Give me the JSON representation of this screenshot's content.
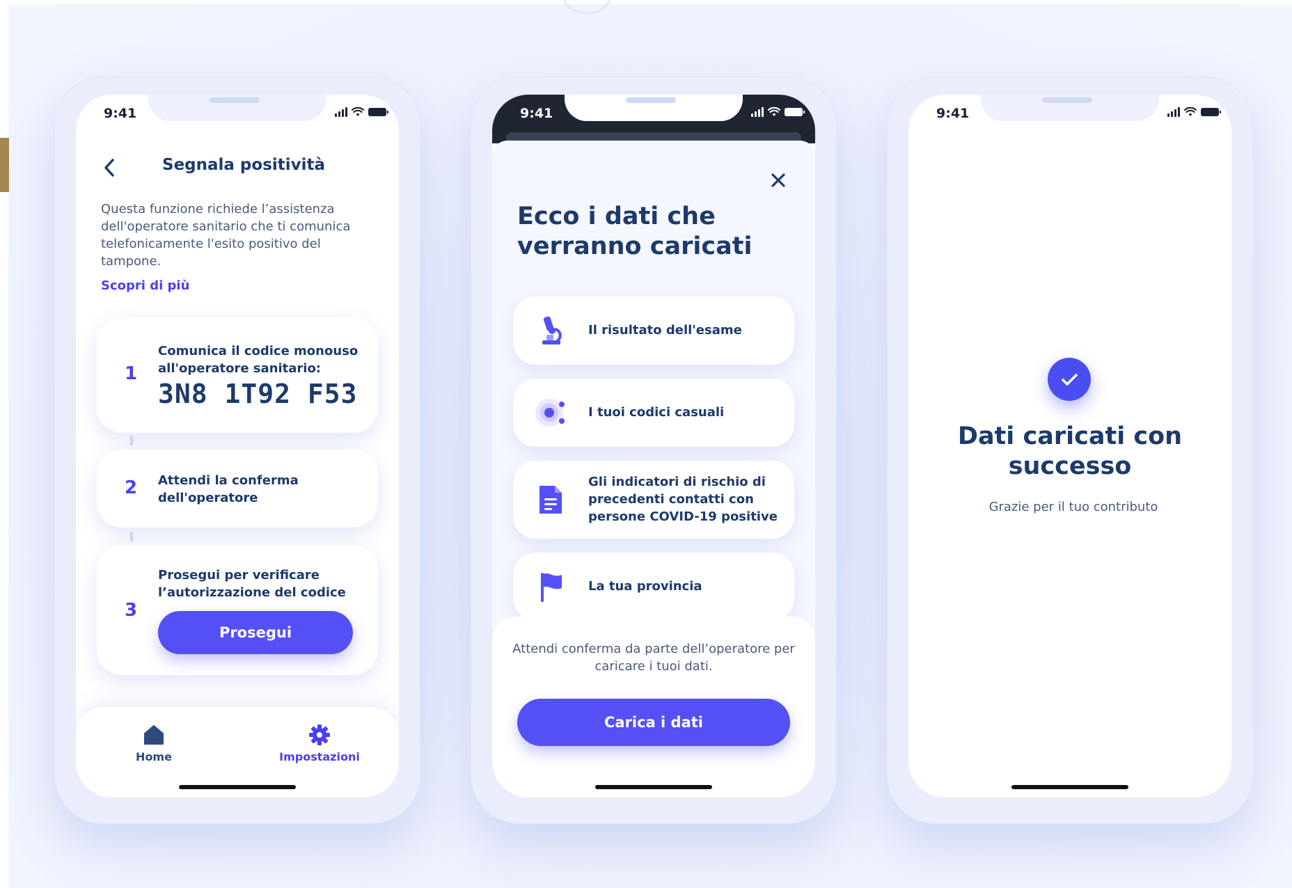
{
  "status_bar": {
    "time": "9:41"
  },
  "phone1": {
    "title": "Segnala positività",
    "description": "Questa funzione richiede l’assistenza dell'operatore sanitario che ti comunica telefonicamente l'esito positivo del tampone.",
    "link": "Scopri di più",
    "steps": [
      {
        "number": "1",
        "text": "Comunica il codice monouso all'operatore sanitario:",
        "code": "3N8 1T92 F53"
      },
      {
        "number": "2",
        "text": "Attendi la conferma dell'operatore"
      },
      {
        "number": "3",
        "text": "Prosegui per verificare l’autorizzazione del codice",
        "button": "Prosegui"
      }
    ],
    "tabs": [
      {
        "label": "Home",
        "icon": "home-icon",
        "color": "#2c4a7e"
      },
      {
        "label": "Impostazioni",
        "icon": "gear-icon",
        "color": "#4d3ff0"
      }
    ]
  },
  "phone2": {
    "title": "Ecco i dati che verranno caricati",
    "items": [
      {
        "label": "Il risultato dell'esame",
        "icon": "microscope-icon"
      },
      {
        "label": "I tuoi codici casuali",
        "icon": "broadcast-icon"
      },
      {
        "label": "Gli indicatori di rischio di precedenti contatti con persone COVID-19 positive",
        "icon": "document-icon"
      },
      {
        "label": "La tua provincia",
        "icon": "flag-icon"
      }
    ],
    "footer_text": "Attendi conferma da parte dell’operatore per caricare i tuoi dati.",
    "button": "Carica i dati"
  },
  "phone3": {
    "title": "Dati caricati con successo",
    "subtitle": "Grazie per il tuo contributo"
  },
  "colors": {
    "accent": "#5450f5",
    "text_dark": "#1d3a6b",
    "text_body": "#4a5a7a"
  }
}
